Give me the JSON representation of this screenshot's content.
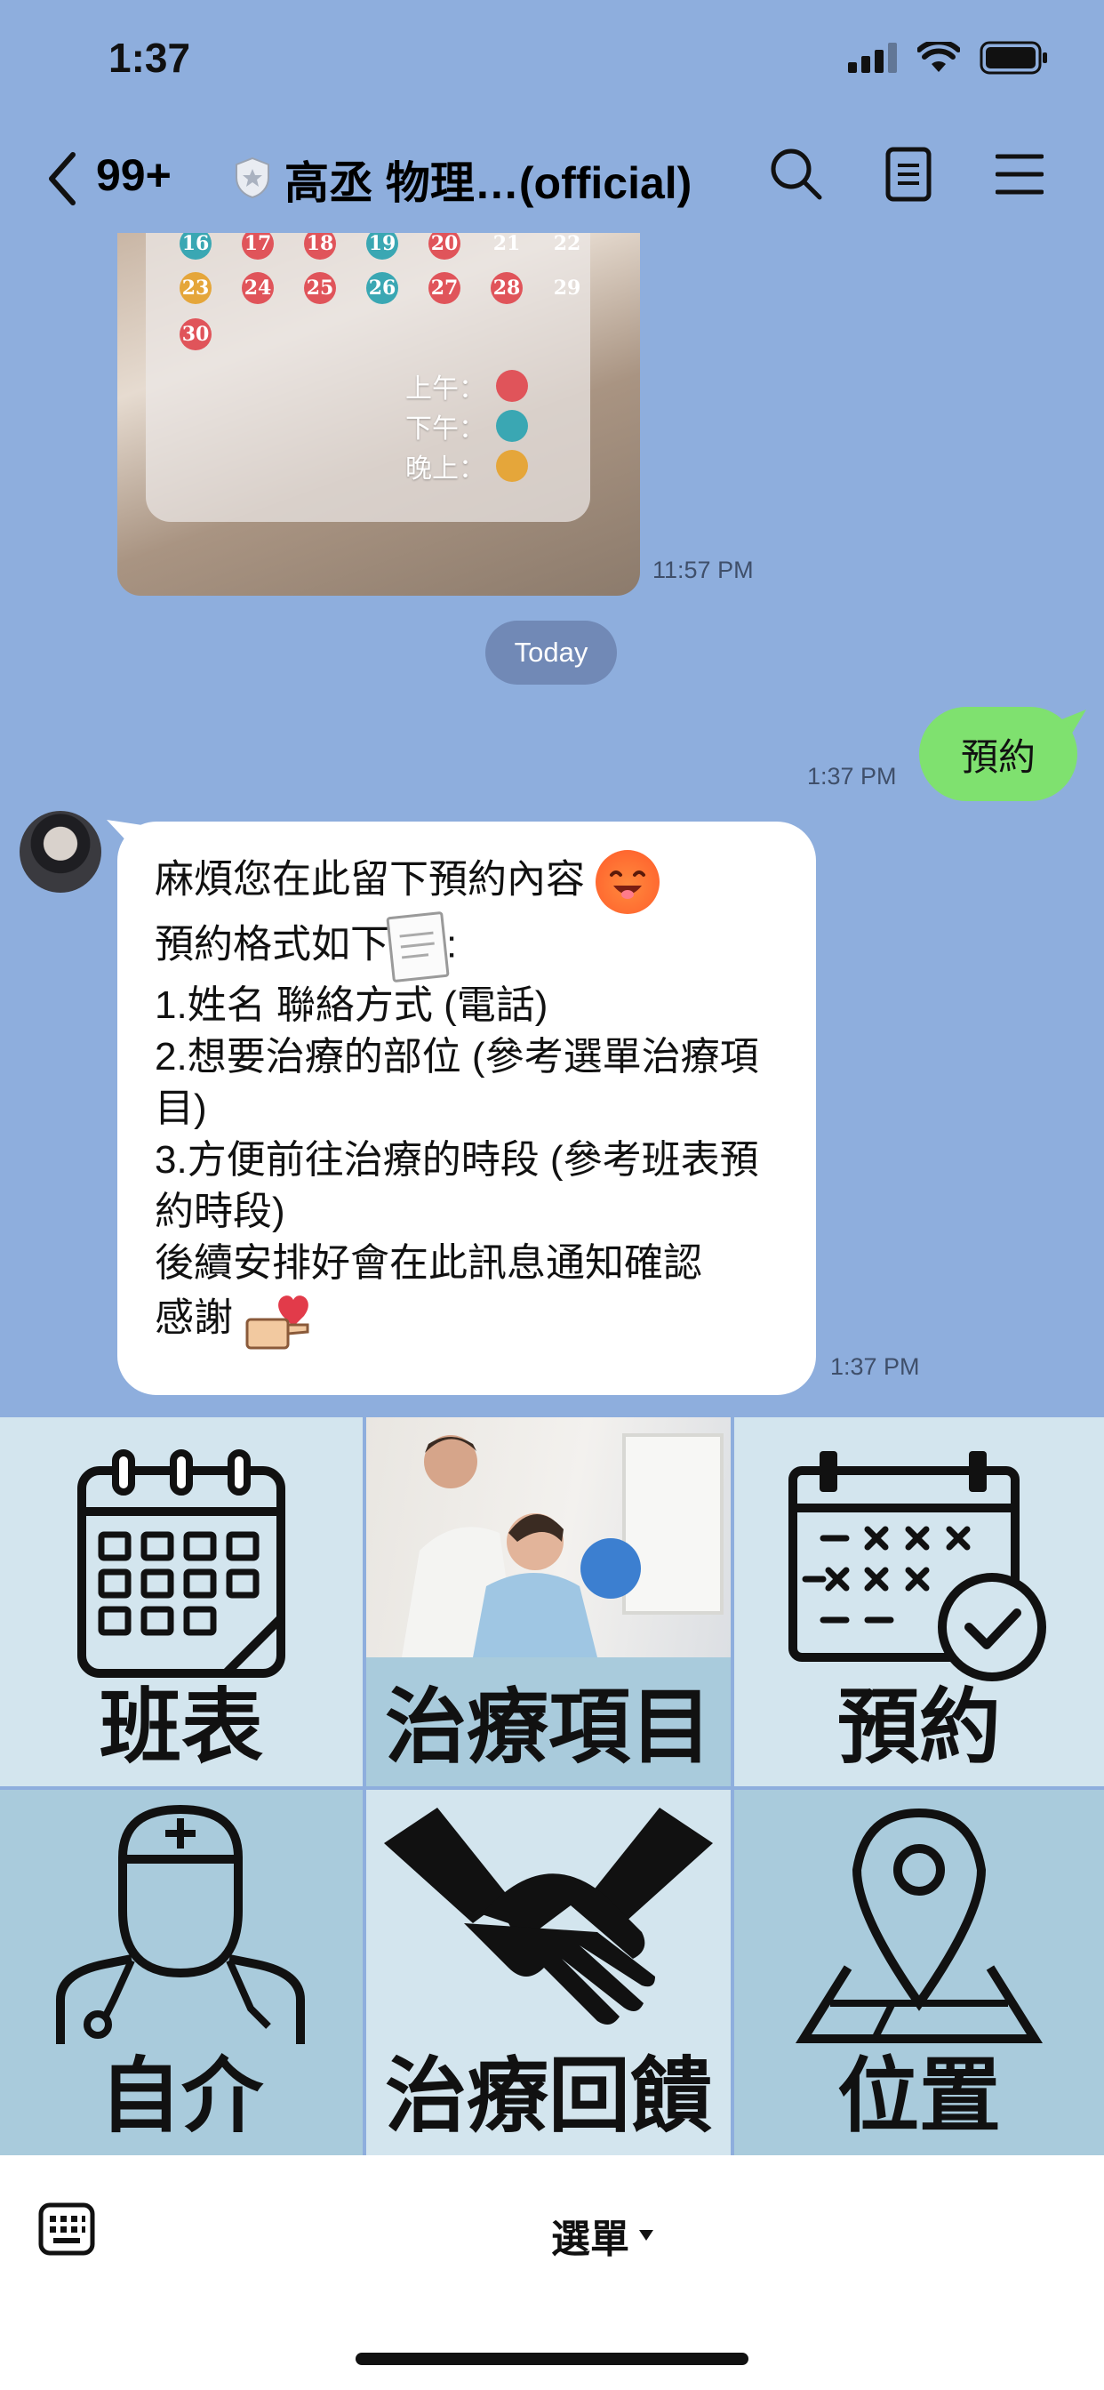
{
  "status_bar": {
    "time": "1:37"
  },
  "header": {
    "unread_count": "99+",
    "title": "高丞 物理…(official)"
  },
  "shared_image": {
    "calendar_days": [
      "16",
      "17",
      "18",
      "19",
      "20",
      "21",
      "22",
      "23",
      "24",
      "25",
      "26",
      "27",
      "28",
      "29",
      "30"
    ],
    "legend": [
      {
        "label": "上午：",
        "color": "#e0545a"
      },
      {
        "label": "下午：",
        "color": "#3aa7b3"
      },
      {
        "label": "晚上：",
        "color": "#e5a63a"
      }
    ],
    "time": "11:57 PM"
  },
  "date_separator": "Today",
  "outgoing_message": {
    "text": "預約",
    "time": "1:37 PM"
  },
  "incoming_message": {
    "lines": [
      "麻煩您在此留下預約內容",
      "預約格式如下",
      ":",
      "1.姓名 聯絡方式 (電話)",
      "2.想要治療的部位 (參考選單治療項目)",
      "3.方便前往治療的時段 (參考班表預約時段)",
      "後續安排好會在此訊息通知確認",
      "感謝"
    ],
    "time": "1:37 PM"
  },
  "rich_menu": {
    "items": [
      {
        "label": "班表"
      },
      {
        "label": "治療項目"
      },
      {
        "label": "預約"
      },
      {
        "label": "自介"
      },
      {
        "label": "治療回饋"
      },
      {
        "label": "位置"
      }
    ],
    "colors": {
      "light": "#d3e5ee",
      "dark": "#a9cbdc"
    }
  },
  "bottom_bar": {
    "menu_label": "選單"
  }
}
